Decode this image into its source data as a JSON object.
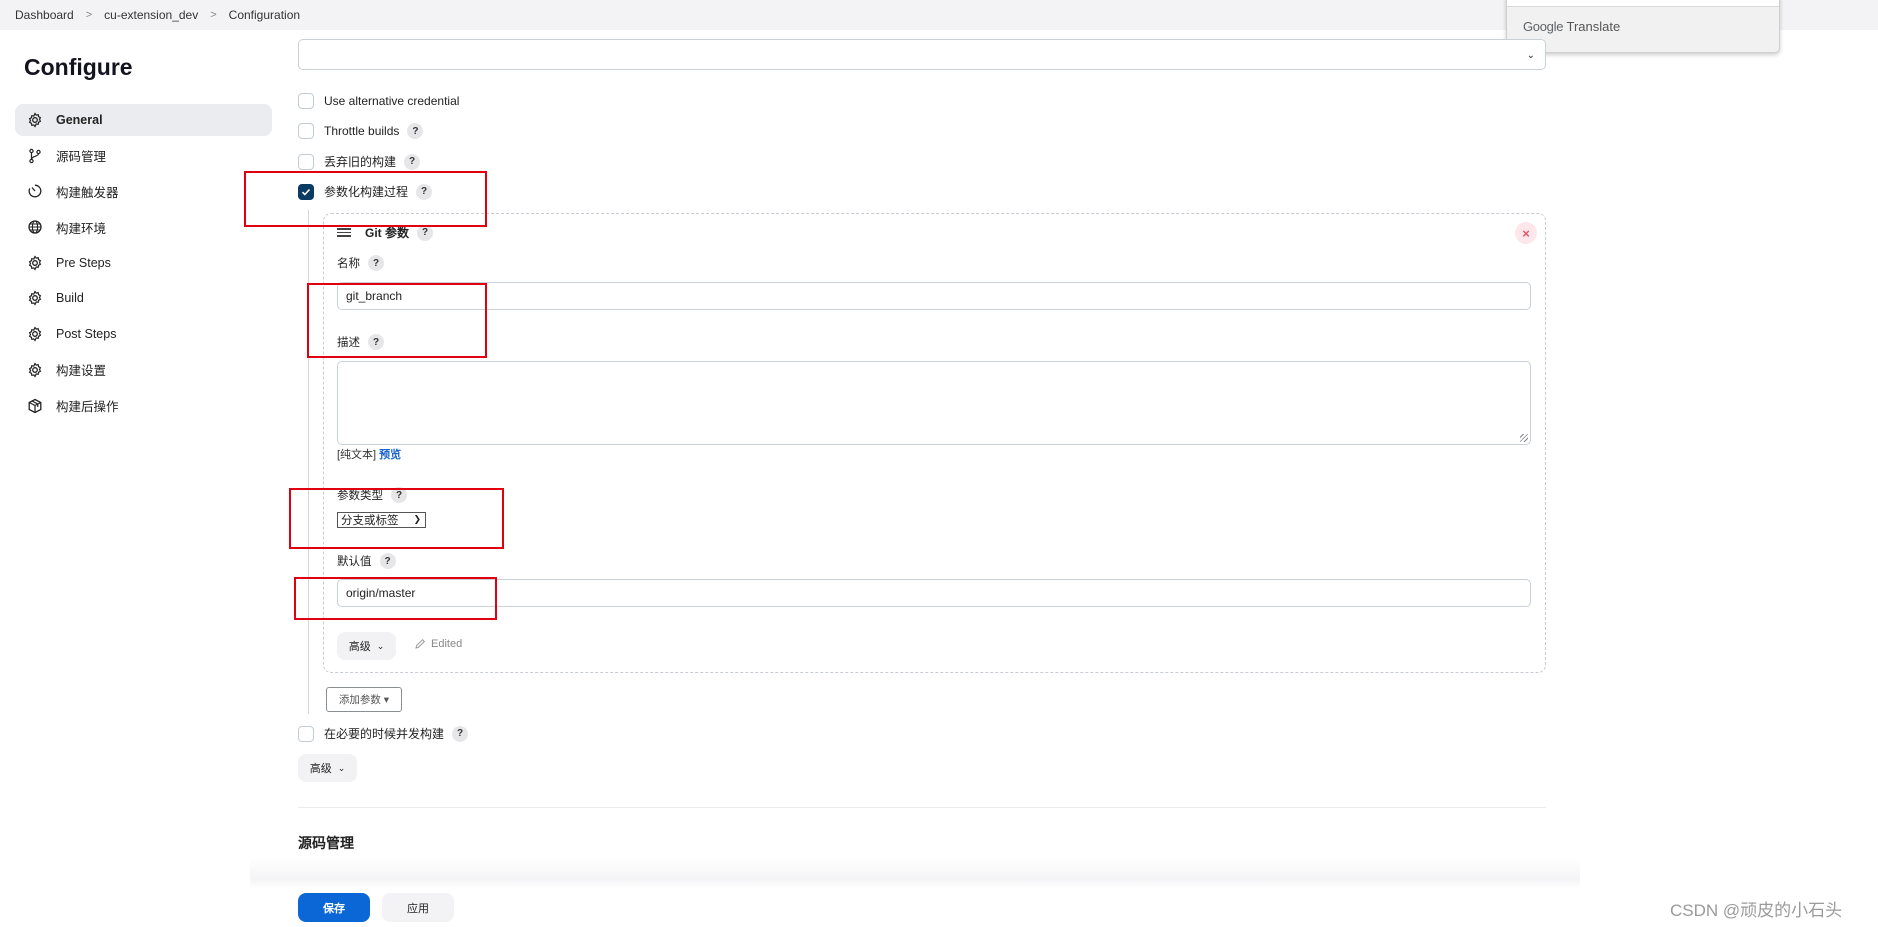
{
  "breadcrumb": [
    "Dashboard",
    "cu-extension_dev",
    "Configuration"
  ],
  "google_translate": {
    "label_google": "Google",
    "label_translate": "Translate"
  },
  "page_title": "Configure",
  "sidebar": {
    "items": [
      {
        "label": "General",
        "icon": "gear-icon",
        "active": true
      },
      {
        "label": "源码管理",
        "icon": "git-branch-icon",
        "active": false
      },
      {
        "label": "构建触发器",
        "icon": "timer-icon",
        "active": false
      },
      {
        "label": "构建环境",
        "icon": "globe-icon",
        "active": false
      },
      {
        "label": "Pre Steps",
        "icon": "gear-icon",
        "active": false
      },
      {
        "label": "Build",
        "icon": "gear-icon",
        "active": false
      },
      {
        "label": "Post Steps",
        "icon": "gear-icon",
        "active": false
      },
      {
        "label": "构建设置",
        "icon": "gear-icon",
        "active": false
      },
      {
        "label": "构建后操作",
        "icon": "package-icon",
        "active": false
      }
    ]
  },
  "general": {
    "top_select_value": "",
    "checkboxes": [
      {
        "label": "Use alternative credential",
        "checked": false,
        "help": false
      },
      {
        "label": "Throttle builds",
        "checked": false,
        "help": true
      },
      {
        "label": "丢弃旧的构建",
        "checked": false,
        "help": true
      },
      {
        "label": "参数化构建过程",
        "checked": true,
        "help": true
      }
    ],
    "parameter": {
      "title": "Git 参数",
      "name_label": "名称",
      "name_value": "git_branch",
      "description_label": "描述",
      "description_value": "",
      "markup_note": "[纯文本]",
      "preview_link": "预览",
      "type_label": "参数类型",
      "type_value": "分支或标签",
      "default_label": "默认值",
      "default_value": "origin/master",
      "advanced_label": "高级",
      "edited_label": "Edited",
      "delete_icon": "×"
    },
    "add_parameter_label": "添加参数 ▾",
    "concurrent_label": "在必要的时候并发构建",
    "advanced_label": "高级"
  },
  "next_section_title": "源码管理",
  "footer": {
    "save_label": "保存",
    "apply_label": "应用"
  },
  "help_glyph": "?",
  "watermark": "CSDN @顽皮的小石头",
  "colors": {
    "primary": "#0b66d6",
    "checkbox_checked": "#0b3a62",
    "annotation": "#e00010",
    "link": "#1a65c9"
  }
}
